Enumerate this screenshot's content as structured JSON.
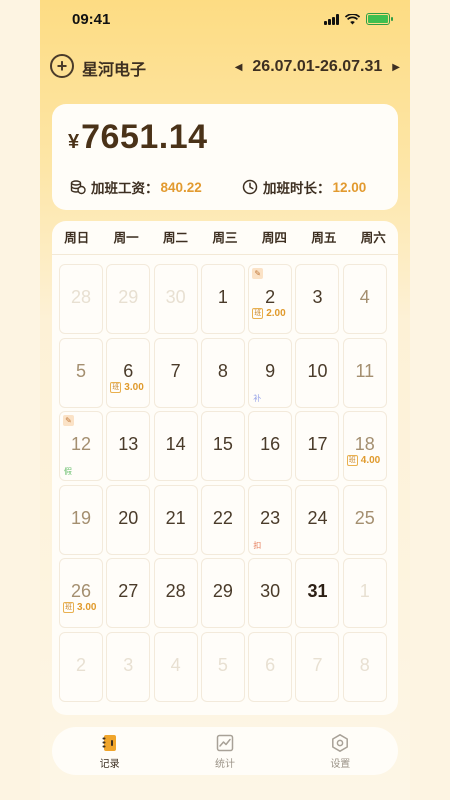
{
  "status_bar": {
    "time": "09:41"
  },
  "header": {
    "company": "星河电子",
    "date_range": "26.07.01-26.07.31",
    "prev_arrow": "◀",
    "next_arrow": "▶"
  },
  "summary": {
    "currency": "¥",
    "total": "7651.14",
    "overtime_pay_label": "加班工资：",
    "overtime_pay_value": "840.22",
    "overtime_hours_label": "加班时长：",
    "overtime_hours_value": "12.00"
  },
  "calendar": {
    "weekdays": [
      "周日",
      "周一",
      "周二",
      "周三",
      "周四",
      "周五",
      "周六"
    ],
    "ot_badge": "班",
    "days": [
      {
        "n": "28",
        "dim": true
      },
      {
        "n": "29",
        "dim": true
      },
      {
        "n": "30",
        "dim": true
      },
      {
        "n": "1"
      },
      {
        "n": "2",
        "note": true,
        "ot": "2.00"
      },
      {
        "n": "3"
      },
      {
        "n": "4",
        "weekend": true
      },
      {
        "n": "5",
        "weekend": true
      },
      {
        "n": "6",
        "ot": "3.00"
      },
      {
        "n": "7"
      },
      {
        "n": "8"
      },
      {
        "n": "9",
        "tag": "补",
        "tag_color": "#9aa6e8"
      },
      {
        "n": "10"
      },
      {
        "n": "11",
        "weekend": true
      },
      {
        "n": "12",
        "weekend": true,
        "note": true,
        "tag": "假",
        "tag_color": "#6cc070"
      },
      {
        "n": "13"
      },
      {
        "n": "14"
      },
      {
        "n": "15"
      },
      {
        "n": "16"
      },
      {
        "n": "17"
      },
      {
        "n": "18",
        "weekend": true,
        "ot": "4.00"
      },
      {
        "n": "19",
        "weekend": true
      },
      {
        "n": "20"
      },
      {
        "n": "21"
      },
      {
        "n": "22"
      },
      {
        "n": "23",
        "tag": "扣",
        "tag_color": "#e57a58"
      },
      {
        "n": "24"
      },
      {
        "n": "25",
        "weekend": true
      },
      {
        "n": "26",
        "weekend": true,
        "ot": "3.00"
      },
      {
        "n": "27"
      },
      {
        "n": "28"
      },
      {
        "n": "29"
      },
      {
        "n": "30"
      },
      {
        "n": "31",
        "today": true
      },
      {
        "n": "1",
        "dim": true
      },
      {
        "n": "2",
        "dim": true
      },
      {
        "n": "3",
        "dim": true
      },
      {
        "n": "4",
        "dim": true
      },
      {
        "n": "5",
        "dim": true
      },
      {
        "n": "6",
        "dim": true
      },
      {
        "n": "7",
        "dim": true
      },
      {
        "n": "8",
        "dim": true
      }
    ]
  },
  "tabs": [
    {
      "label": "记录",
      "icon": "record-icon",
      "active": true
    },
    {
      "label": "统计",
      "icon": "chart-icon",
      "active": false
    },
    {
      "label": "设置",
      "icon": "settings-icon",
      "active": false
    }
  ],
  "colors": {
    "accent": "#e29a2f",
    "primary_text": "#3d2f21",
    "background_top": "#fddc83"
  }
}
